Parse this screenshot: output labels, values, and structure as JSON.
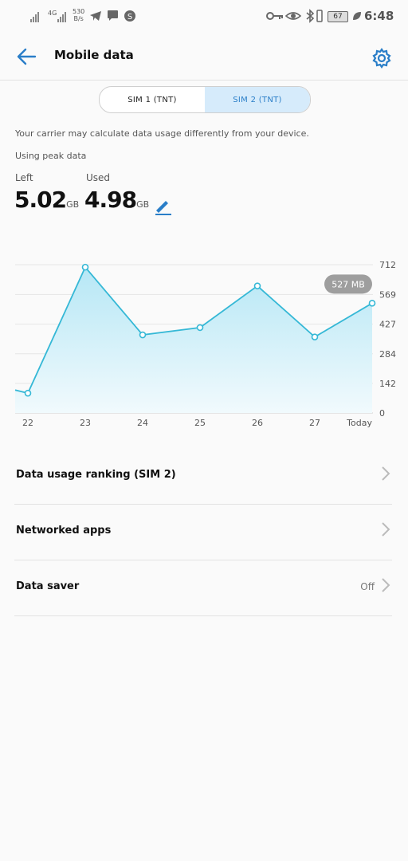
{
  "status_bar": {
    "network": "4G",
    "speed_value": "530",
    "speed_unit": "B/s",
    "battery": "67",
    "time": "6:48"
  },
  "header": {
    "title": "Mobile data"
  },
  "sim_tabs": [
    {
      "label": "SIM 1 (TNT)",
      "active": false
    },
    {
      "label": "SIM 2 (TNT)",
      "active": true
    }
  ],
  "carrier_note": "Your carrier may calculate data usage differently from your device.",
  "peak_note": "Using peak data",
  "usage": {
    "left_label": "Left",
    "left_value": "5.02",
    "left_unit": "GB",
    "used_label": "Used",
    "used_value": "4.98",
    "used_unit": "GB"
  },
  "chart_data": {
    "type": "area",
    "x": [
      "",
      "22",
      "23",
      "24",
      "25",
      "26",
      "27",
      "Today"
    ],
    "series": [
      {
        "values": [
          110,
          95,
          700,
          375,
          410,
          610,
          365,
          527
        ]
      }
    ],
    "yticks": [
      "712",
      "569",
      "427",
      "284",
      "142",
      "0"
    ],
    "ylim": [
      0,
      712
    ],
    "tooltip": "527 MB",
    "grid": true,
    "colors": {
      "line": "#35b8d6",
      "fill_top": "#b6e7f5",
      "fill_bottom": "#f1fafd",
      "tooltip_bg": "#9e9e9e"
    }
  },
  "list": [
    {
      "label": "Data usage ranking (SIM 2)",
      "value": ""
    },
    {
      "label": "Networked apps",
      "value": ""
    },
    {
      "label": "Data saver",
      "value": "Off"
    }
  ],
  "colors": {
    "accent": "#2a7ec8"
  }
}
